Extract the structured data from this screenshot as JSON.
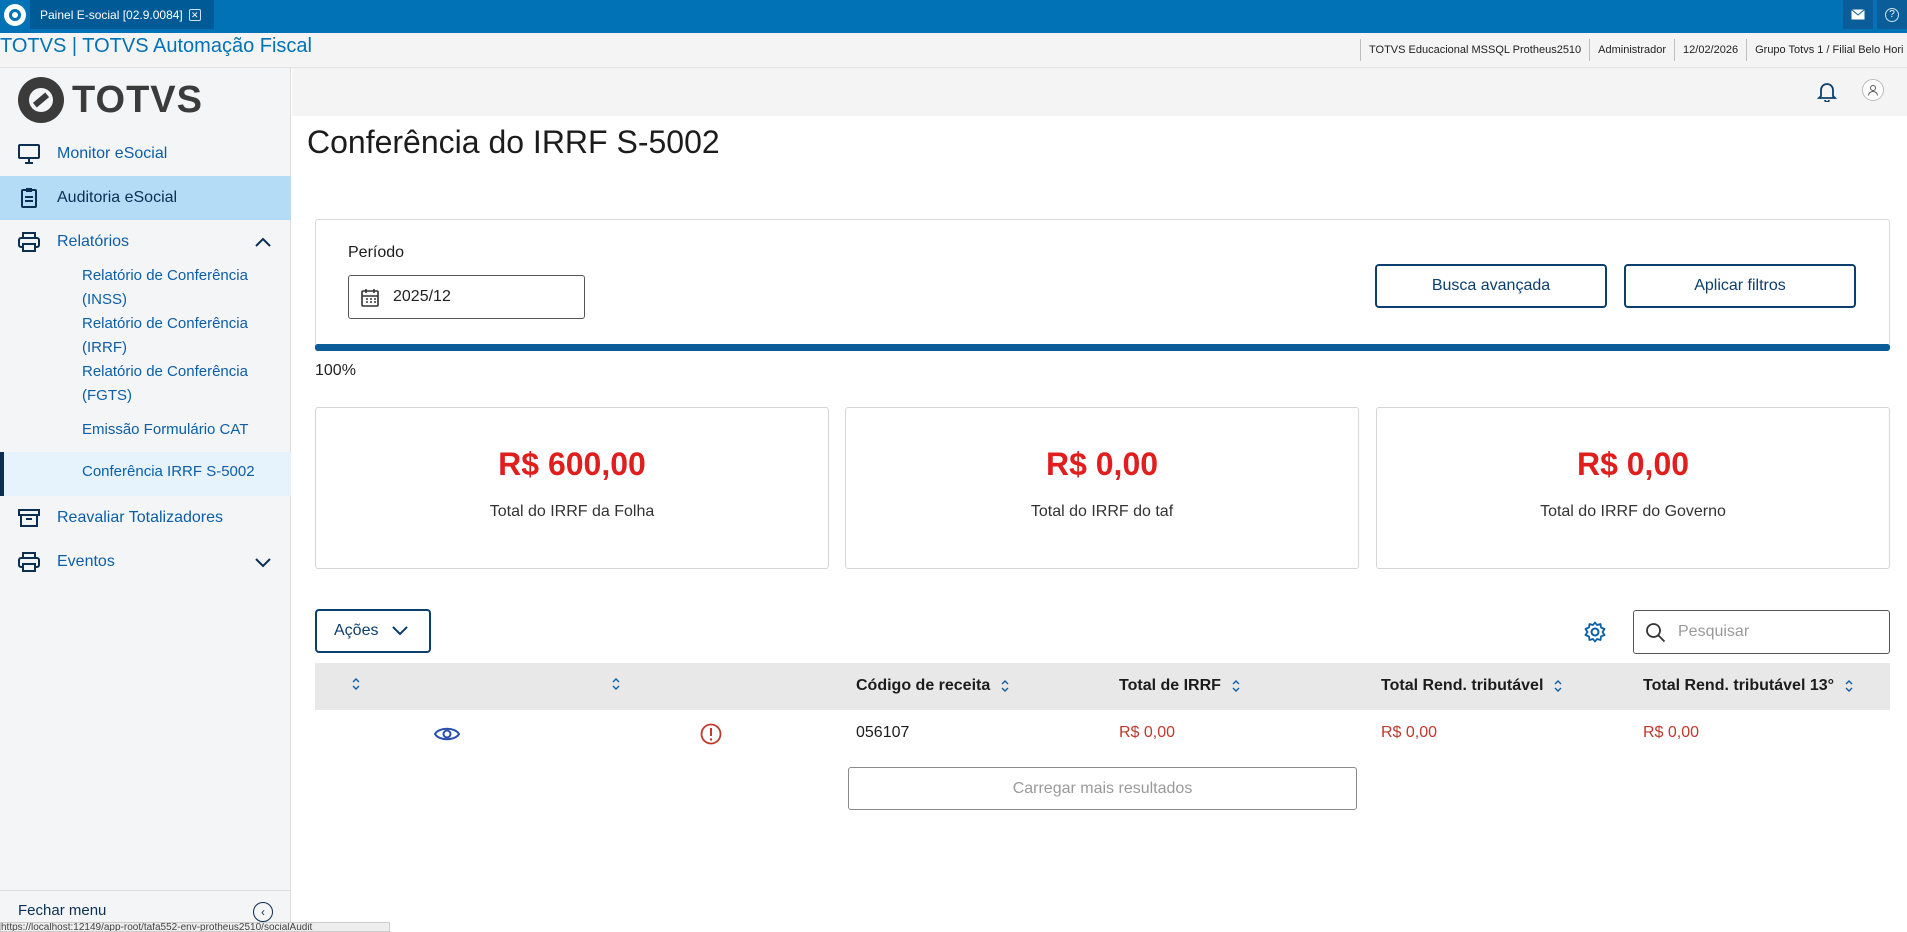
{
  "window": {
    "tab_title": "Painel E-social [02.9.0084]"
  },
  "header": {
    "app_title": "TOTVS | TOTVS Automação Fiscal",
    "environment": "TOTVS Educacional MSSQL Protheus2510",
    "user": "Administrador",
    "date": "12/02/2026",
    "branch": "Grupo Totvs 1 / Filial Belo Hori"
  },
  "sidebar": {
    "brand": "TOTVS",
    "items": [
      {
        "label": "Monitor eSocial"
      },
      {
        "label": "Auditoria eSocial"
      },
      {
        "label": "Relatórios"
      },
      {
        "label": "Reavaliar Totalizadores"
      },
      {
        "label": "Eventos"
      }
    ],
    "subitems": [
      {
        "label": "Relatório de Conferência (INSS)"
      },
      {
        "label": "Relatório de Conferência (IRRF)"
      },
      {
        "label": "Relatório de Conferência (FGTS)"
      },
      {
        "label": "Emissão Formulário CAT"
      },
      {
        "label": "Conferência IRRF S-5002"
      }
    ],
    "footer_label": "Fechar menu"
  },
  "status_url": "https://localhost:12149/app-root/tafa552-env-protheus2510/socialAudit",
  "page": {
    "title": "Conferência do IRRF S-5002",
    "periodo_label": "Período",
    "periodo_value": "2025/12",
    "busca_button": "Busca avançada",
    "aplicar_button": "Aplicar filtros",
    "progress_fraction": 1.0,
    "progress_text": "100%"
  },
  "kpis": [
    {
      "amount": "R$ 600,00",
      "label": "Total do IRRF da Folha"
    },
    {
      "amount": "R$ 0,00",
      "label": "Total do IRRF do taf"
    },
    {
      "amount": "R$ 0,00",
      "label": "Total do IRRF do Governo"
    }
  ],
  "table": {
    "actions_label": "Ações",
    "search_placeholder": "Pesquisar",
    "columns": [
      "",
      "",
      "Código de receita",
      "Total de IRRF",
      "Total Rend. tributável",
      "Total Rend. tributável 13°"
    ],
    "rows": [
      {
        "codigo": "056107",
        "total_irrf": "R$ 0,00",
        "rend_trib": "R$ 0,00",
        "rend_trib_13": "R$ 0,00"
      }
    ],
    "load_more": "Carregar mais resultados"
  },
  "colors": {
    "primary": "#0172b6",
    "accent_dark": "#0b3f6e",
    "danger": "#e01e1e",
    "nav_active": "#b4dcf7"
  }
}
